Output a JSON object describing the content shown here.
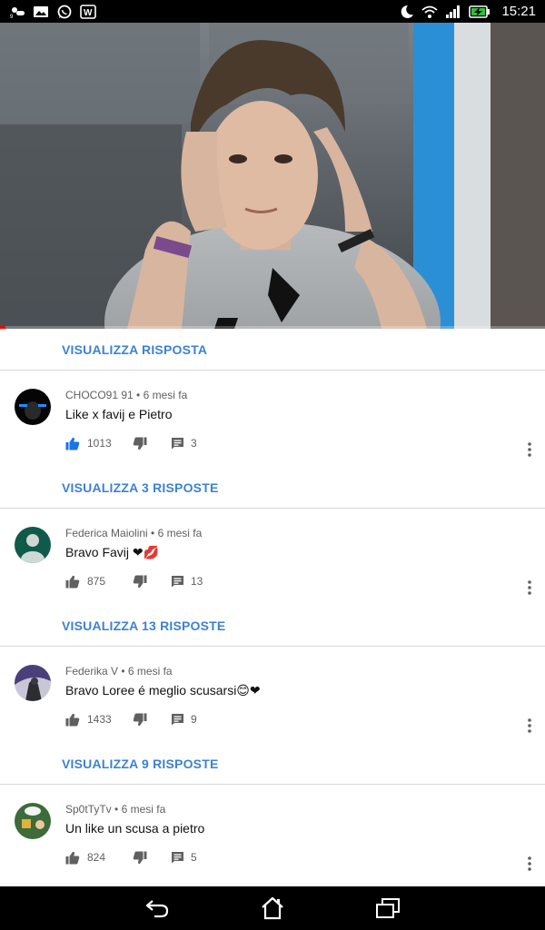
{
  "status_bar": {
    "time": "15:21",
    "left_icons": [
      "weather-icon",
      "image-icon",
      "whatsapp-icon",
      "app-icon"
    ],
    "right_icons": [
      "moon-icon",
      "wifi-icon",
      "signal-icon",
      "battery-charging-icon"
    ]
  },
  "video": {
    "progress_fraction": 0.01,
    "colors": {
      "progress": "#ff0000"
    }
  },
  "accent_color": "#3e82d0",
  "top_view_replies": "VISUALIZZA RISPOSTA",
  "comments": [
    {
      "author": "CHOCO91 91",
      "time": "6 mesi fa",
      "text": "Like x favij e Pietro",
      "likes": "1013",
      "replies": "3",
      "liked": true,
      "view_replies": "VISUALIZZA 3 RISPOSTE"
    },
    {
      "author": "Federica Maiolini",
      "time": "6 mesi fa",
      "text": "Bravo Favij ❤💋",
      "likes": "875",
      "replies": "13",
      "liked": false,
      "view_replies": "VISUALIZZA 13 RISPOSTE"
    },
    {
      "author": "Federika V",
      "time": "6 mesi fa",
      "text": "Bravo Loree é meglio scusarsi😊❤",
      "likes": "1433",
      "replies": "9",
      "liked": false,
      "view_replies": "VISUALIZZA 9 RISPOSTE"
    },
    {
      "author": "Sp0tTyTv",
      "time": "6 mesi fa",
      "text": "Un like un scusa a pietro",
      "likes": "824",
      "replies": "5",
      "liked": false,
      "view_replies": ""
    }
  ],
  "nav_bar": {
    "buttons": [
      "back-icon",
      "home-icon",
      "recents-icon"
    ]
  }
}
